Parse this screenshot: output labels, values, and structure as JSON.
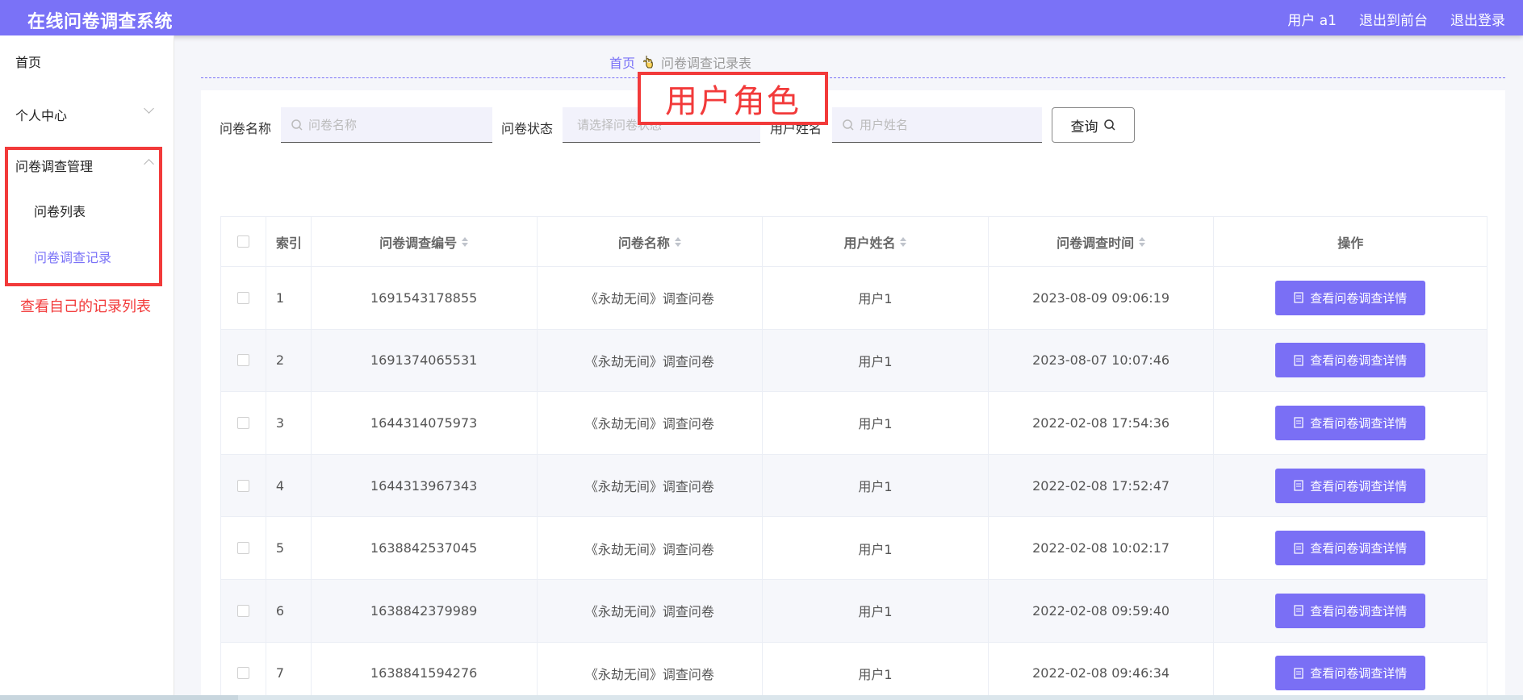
{
  "header": {
    "title": "在线问卷调查系统",
    "links": [
      "用户 a1",
      "退出到前台",
      "退出登录"
    ]
  },
  "sidebar": {
    "items": [
      {
        "label": "首页"
      },
      {
        "label": "个人中心"
      },
      {
        "label": "问卷调查管理"
      }
    ],
    "sub_items": [
      {
        "label": "问卷列表"
      },
      {
        "label": "问卷调查记录"
      }
    ],
    "annotation": "查看自己的记录列表"
  },
  "breadcrumb": {
    "home": "首页",
    "current": "问卷调查记录表"
  },
  "overlay": {
    "text": "用户角色"
  },
  "filters": {
    "name_label": "问卷名称",
    "name_placeholder": "问卷名称",
    "status_label": "问卷状态",
    "status_placeholder": "请选择问卷状态",
    "user_label": "用户姓名",
    "user_placeholder": "用户姓名",
    "query_button": "查询"
  },
  "table": {
    "headers": [
      "索引",
      "问卷调查编号",
      "问卷名称",
      "用户姓名",
      "问卷调查时间",
      "操作"
    ],
    "action_label": "查看问卷调查详情",
    "rows": [
      {
        "idx": "1",
        "num": "1691543178855",
        "name": "《永劫无间》调查问卷",
        "user": "用户1",
        "time": "2023-08-09 09:06:19"
      },
      {
        "idx": "2",
        "num": "1691374065531",
        "name": "《永劫无间》调查问卷",
        "user": "用户1",
        "time": "2023-08-07 10:07:46"
      },
      {
        "idx": "3",
        "num": "1644314075973",
        "name": "《永劫无间》调查问卷",
        "user": "用户1",
        "time": "2022-02-08 17:54:36"
      },
      {
        "idx": "4",
        "num": "1644313967343",
        "name": "《永劫无间》调查问卷",
        "user": "用户1",
        "time": "2022-02-08 17:52:47"
      },
      {
        "idx": "5",
        "num": "1638842537045",
        "name": "《永劫无间》调查问卷",
        "user": "用户1",
        "time": "2022-02-08 10:02:17"
      },
      {
        "idx": "6",
        "num": "1638842379989",
        "name": "《永劫无间》调查问卷",
        "user": "用户1",
        "time": "2022-02-08 09:59:40"
      },
      {
        "idx": "7",
        "num": "1638841594276",
        "name": "《永劫无间》调查问卷",
        "user": "用户1",
        "time": "2022-02-08 09:46:34"
      }
    ]
  },
  "colors": {
    "accent": "#7a72f7",
    "annotation_red": "#f23a3a"
  }
}
